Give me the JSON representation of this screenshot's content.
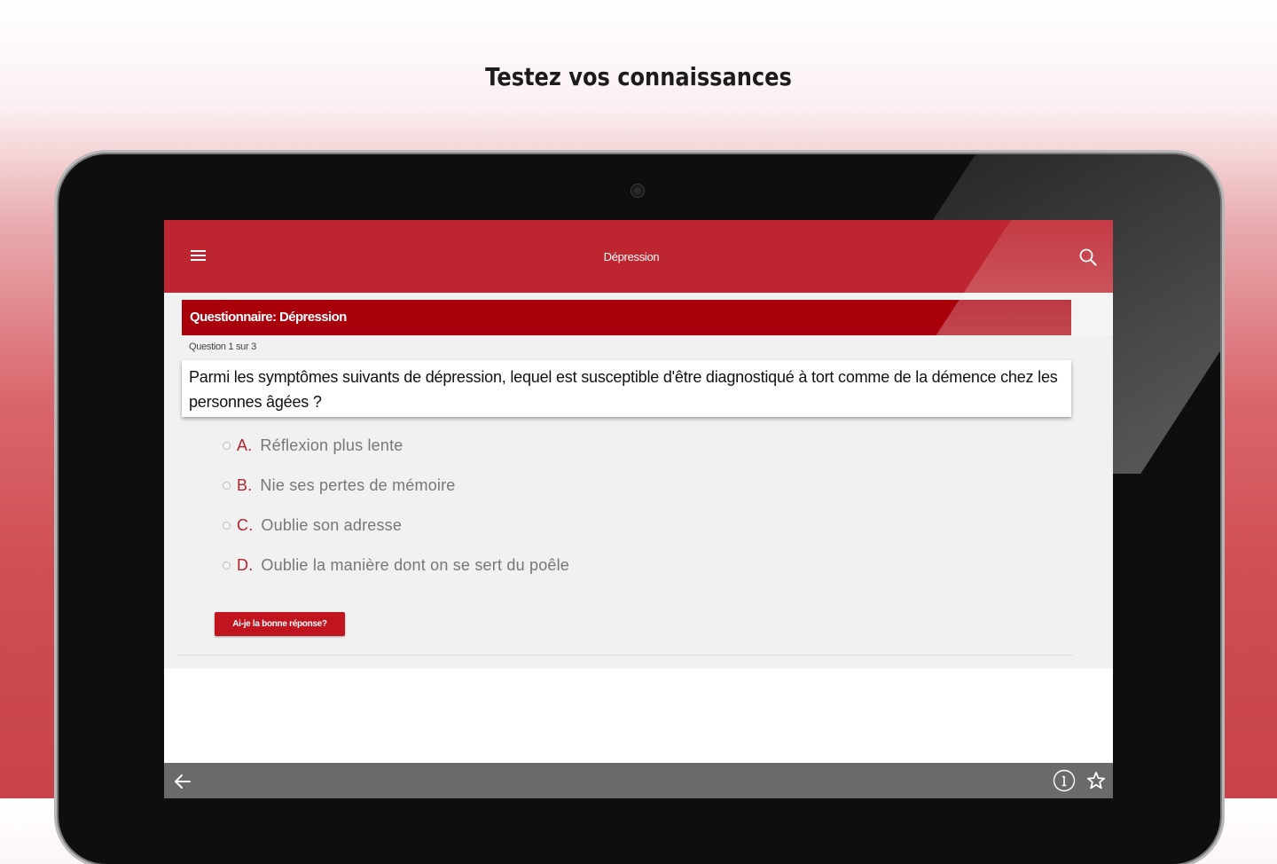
{
  "promo": {
    "headline": "Testez vos connaissances"
  },
  "app_bar": {
    "title": "Dépression",
    "menu_icon": "hamburger-menu-icon",
    "search_icon": "search-icon"
  },
  "quiz": {
    "header": "Questionnaire: Dépression",
    "counter": "Question 1 sur 3",
    "question": "Parmi les symptômes suivants de dépression, lequel est susceptible d'être diagnostiqué à tort comme de la démence chez les personnes âgées ?",
    "options": [
      {
        "letter": "A.",
        "text": "Réflexion plus lente"
      },
      {
        "letter": "B.",
        "text": "Nie ses pertes de mémoire"
      },
      {
        "letter": "C.",
        "text": "Oublie son adresse"
      },
      {
        "letter": "D.",
        "text": "Oublie la manière dont on se sert du poêle"
      }
    ],
    "check_button": "Ai-je la bonne réponse?"
  },
  "bottom_bar": {
    "back_icon": "arrow-left-icon",
    "info_icon": "info-circle-icon",
    "star_icon": "star-icon"
  },
  "colors": {
    "app_bar": "#bd2530",
    "quiz_header": "#a9000c",
    "accent_letter": "#b3232c",
    "button": "#c0141f",
    "bottom_bar": "#6a6a6a"
  }
}
